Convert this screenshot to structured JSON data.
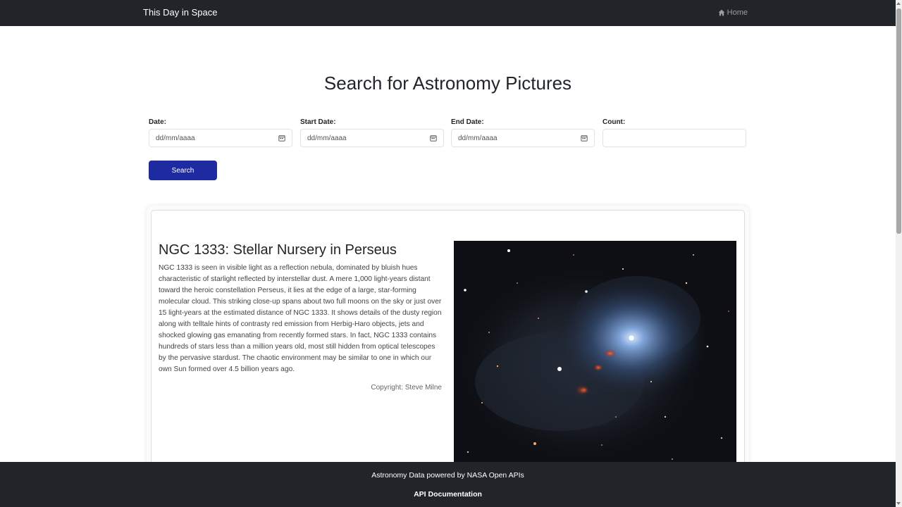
{
  "navbar": {
    "brand": "This Day in Space",
    "home_label": "Home"
  },
  "page": {
    "title": "Search for Astronomy Pictures"
  },
  "form": {
    "date": {
      "label": "Date:",
      "value": "dd/mm/aaaa"
    },
    "start_date": {
      "label": "Start Date:",
      "value": "dd/mm/aaaa"
    },
    "end_date": {
      "label": "End Date:",
      "value": "dd/mm/aaaa"
    },
    "count": {
      "label": "Count:",
      "value": ""
    },
    "search_label": "Search"
  },
  "apod": {
    "title": "NGC 1333: Stellar Nursery in Perseus",
    "explanation": "NGC 1333 is seen in visible light as a reflection nebula, dominated by bluish hues characteristic of starlight reflected by interstellar dust. A mere 1,000 light-years distant toward the heroic constellation Perseus, it lies at the edge of a large, star-forming molecular cloud. This striking close-up spans about two full moons on the sky or just over 15 light-years at the estimated distance of NGC 1333. It shows details of the dusty region along with telltale hints of contrasty red emission from Herbig-Haro objects, jets and shocked glowing gas emanating from recently formed stars. In fact, NGC 1333 contains hundreds of stars less than a million years old, most still hidden from optical telescopes by the pervasive stardust. The chaotic environment may be similar to one in which our own Sun formed over 4.5 billion years ago.",
    "copyright": "Copyright: Steve Milne"
  },
  "footer": {
    "text": "Astronomy Data powered by NASA Open APIs",
    "link": "API Documentation"
  },
  "colors": {
    "navbar": "#212529",
    "search_button": "#1d2aa0"
  }
}
